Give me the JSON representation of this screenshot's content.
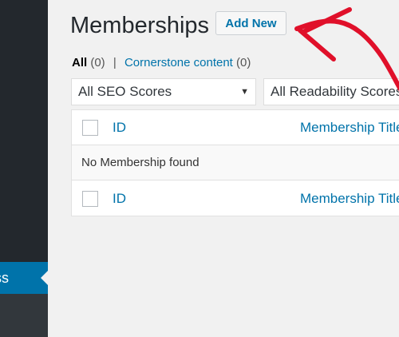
{
  "sidebar": {
    "active_item": "ss"
  },
  "page": {
    "title": "Memberships",
    "add_new_label": "Add New"
  },
  "views": {
    "all_label": "All",
    "all_count": "(0)",
    "separator": "|",
    "cornerstone_label": "Cornerstone content",
    "cornerstone_count": "(0)"
  },
  "filters": {
    "seo_scores": "All SEO Scores",
    "readability_scores": "All Readability Scores"
  },
  "table": {
    "columns": [
      "ID",
      "Membership Title"
    ],
    "empty_message": "No Membership found",
    "footer_columns": [
      "ID",
      "Membership Title"
    ]
  },
  "colors": {
    "sidebar": "#23282d",
    "sidebar_active": "#0073aa",
    "link": "#0073aa",
    "annotation_arrow": "#e0102a"
  },
  "icons": {
    "select_caret": "caret-down-icon"
  }
}
